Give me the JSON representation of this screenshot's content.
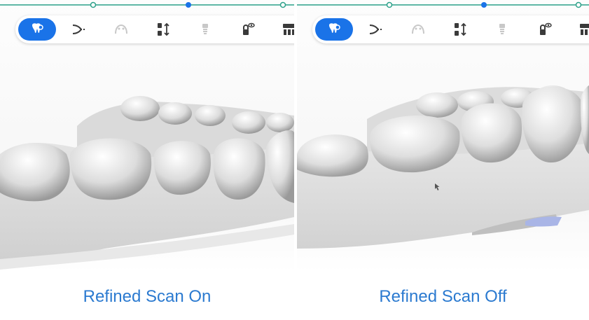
{
  "colors": {
    "accent": "#1a73e8",
    "progress_line": "#2ba089",
    "caption": "#2b7ad0",
    "icon_dark": "#3a3a3a",
    "icon_disabled": "#c8c8c8"
  },
  "toolbar": {
    "icons": [
      "tooth-scan-icon",
      "jaw-trim-icon",
      "arch-icon",
      "bite-align-icon",
      "implant-icon",
      "scan-view-icon",
      "bridge-icon"
    ],
    "active_index": 0
  },
  "panels": {
    "left": {
      "caption": "Refined Scan On"
    },
    "right": {
      "caption": "Refined Scan Off"
    }
  }
}
